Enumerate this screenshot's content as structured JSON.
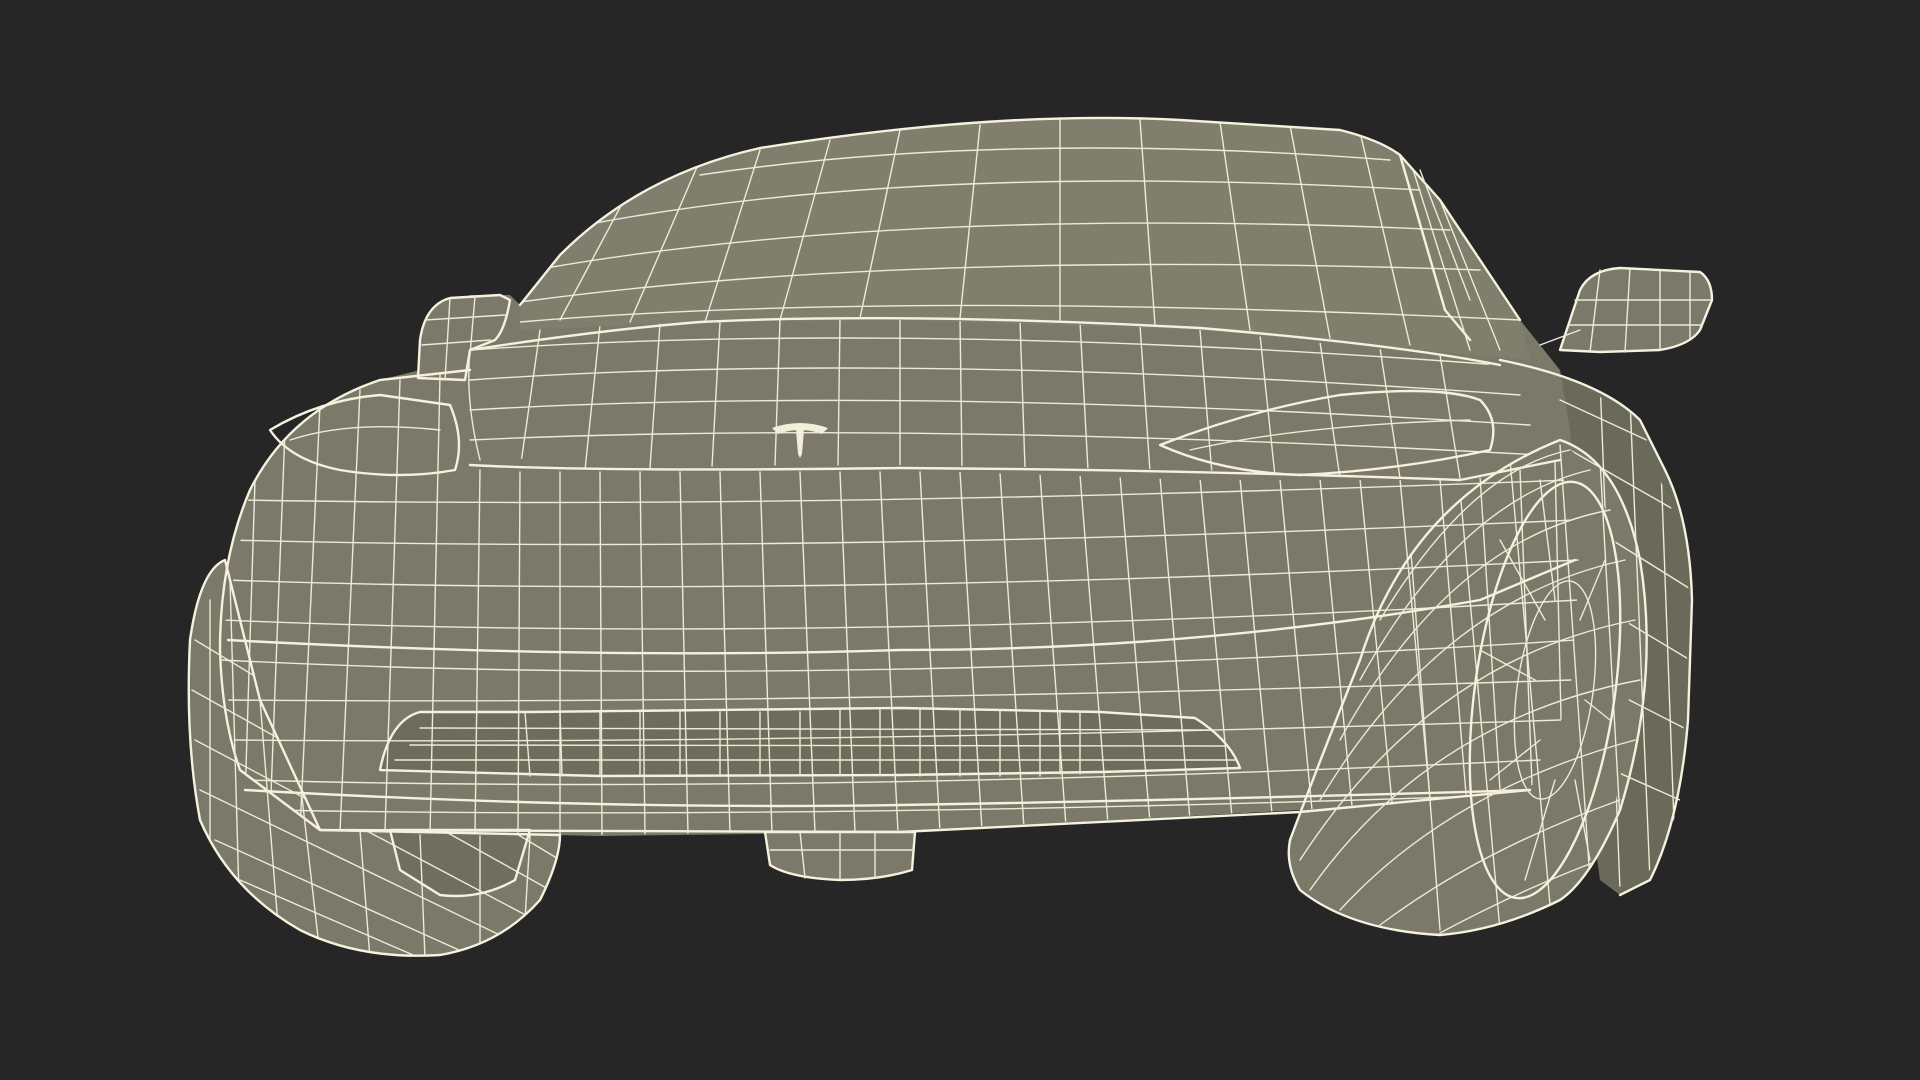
{
  "scene": {
    "subject": "car",
    "render_style": "wireframe",
    "view": "front-three-quarter",
    "colors": {
      "background": "#262626",
      "surface": "#7b7a6a",
      "wire": "#ecebd6"
    }
  },
  "emblem": {
    "icon": "brand-emblem-icon"
  }
}
